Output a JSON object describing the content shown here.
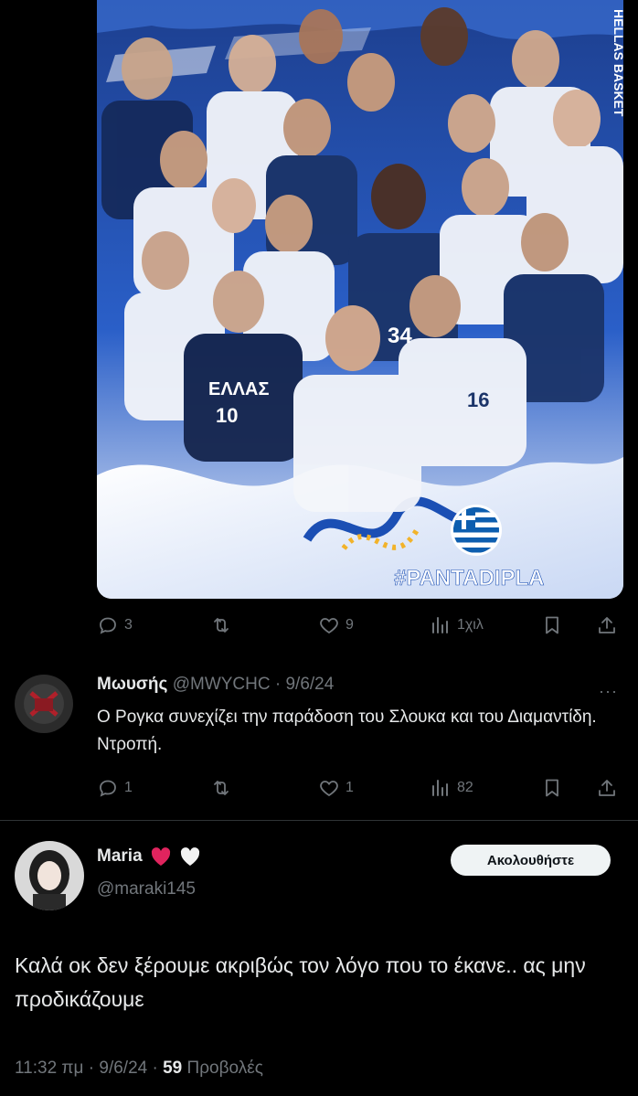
{
  "media": {
    "side_text": "HELLAS BASKET",
    "hashtag": "#PANTADIPLA",
    "jersey_text": "ΕΛΛΑΣ",
    "numbers": [
      "10",
      "34",
      "16"
    ]
  },
  "post_actions": {
    "replies": "3",
    "reposts": "",
    "likes": "9",
    "views": "1χιλ"
  },
  "reply": {
    "name": "Μωυσής",
    "handle": "@MWYCHC",
    "separator": "·",
    "date": "9/6/24",
    "text": "Ο Ρογκα συνεχίζει την παράδοση του Σλουκα και του Διαμαντίδη. Ντροπή.",
    "more": "···",
    "actions": {
      "replies": "1",
      "reposts": "",
      "likes": "1",
      "views": "82"
    }
  },
  "main": {
    "name": "Maria",
    "handle": "@maraki145",
    "follow_label": "Ακολουθήστε",
    "text": "Καλά οκ δεν ξέρουμε ακριβώς τον λόγο που το έκανε.. ας μην προδικάζουμε",
    "time": "11:32 πμ",
    "dot": "·",
    "date": "9/6/24",
    "views_count": "59",
    "views_label": "Προβολές"
  },
  "colors": {
    "background": "#000000",
    "muted": "#71767b",
    "text": "#e7e9ea",
    "heart": "#e0245e",
    "poster_blue": "#1b4fb4"
  }
}
